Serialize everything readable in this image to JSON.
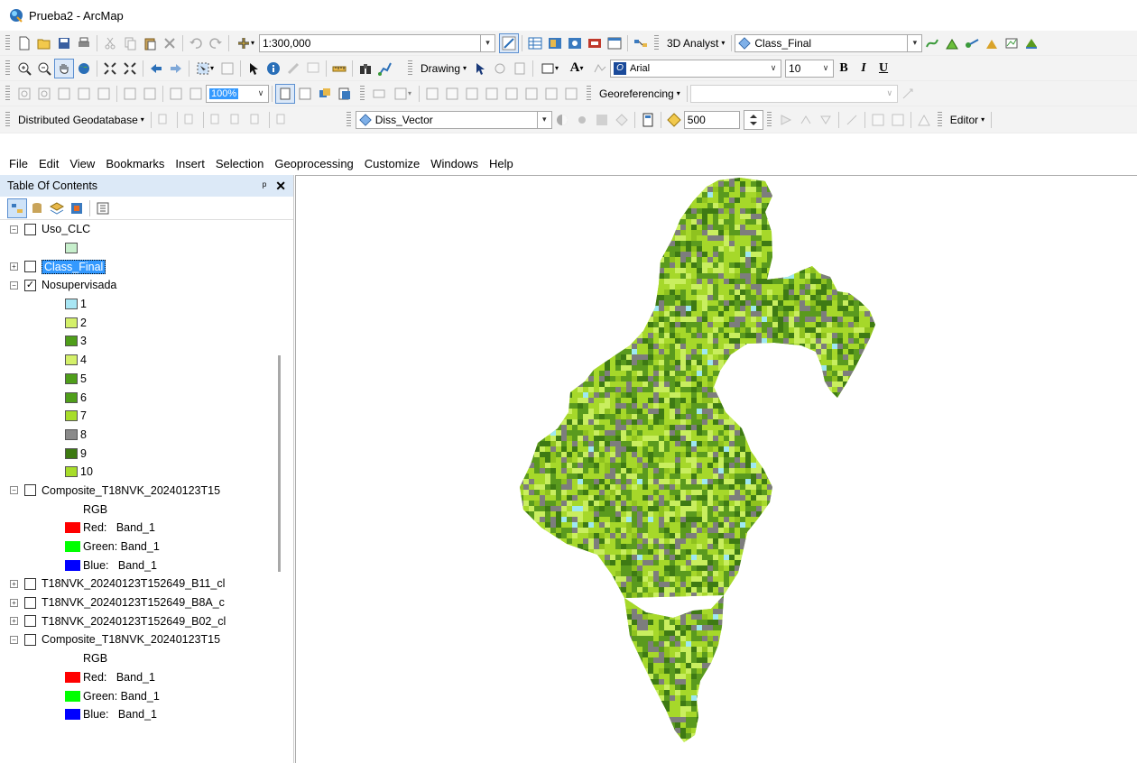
{
  "window": {
    "title": "Prueba2 - ArcMap"
  },
  "toolbar1": {
    "scale": "1:300,000",
    "analyst_label": "3D Analyst",
    "layer_combo": "Class_Final"
  },
  "toolbar2": {
    "drawing_label": "Drawing",
    "font_name": "Arial",
    "font_size": "10",
    "bold": "B",
    "italic": "I",
    "underline": "U"
  },
  "toolbar3": {
    "zoom_value": "100%",
    "georef_label": "Georeferencing"
  },
  "toolbar4": {
    "dist_geodb_label": "Distributed Geodatabase",
    "layer_combo": "Diss_Vector",
    "tolerance_value": "500",
    "editor_label": "Editor"
  },
  "menu": [
    "File",
    "Edit",
    "View",
    "Bookmarks",
    "Insert",
    "Selection",
    "Geoprocessing",
    "Customize",
    "Windows",
    "Help"
  ],
  "toc": {
    "title": "Table Of Contents",
    "layers": [
      {
        "name": "Uso_CLC"
      },
      {
        "name": "Class_Final"
      },
      {
        "name": "Nosupervisada"
      },
      {
        "name": "Composite_T18NVK_20240123T15"
      },
      {
        "name": "T18NVK_20240123T152649_B11_cl"
      },
      {
        "name": "T18NVK_20240123T152649_B8A_c"
      },
      {
        "name": "T18NVK_20240123T152649_B02_cl"
      },
      {
        "name": "Composite_T18NVK_20240123T15"
      }
    ],
    "classes": [
      "1",
      "2",
      "3",
      "4",
      "5",
      "6",
      "7",
      "8",
      "9",
      "10"
    ],
    "class_colors": [
      "#a8e6f4",
      "#d4f06a",
      "#4f9e1a",
      "#d4f06a",
      "#4f9e1a",
      "#4f9e1a",
      "#a8dd2a",
      "#8a8a8a",
      "#3d7a12",
      "#a8dd2a"
    ],
    "uso_color": "#c7efcc",
    "rgb_label": "RGB",
    "band_labels": [
      "Red:   Band_1",
      "Green: Band_1",
      "Blue:   Band_1"
    ],
    "band_colors": [
      "#ff0000",
      "#00ff00",
      "#0000ff"
    ]
  },
  "map": {
    "palette": [
      "#a6d82a",
      "#5a9a1e",
      "#c9ee5f",
      "#7d7d7d",
      "#3e7a14",
      "#8fc21f",
      "#9ee8f2"
    ]
  }
}
